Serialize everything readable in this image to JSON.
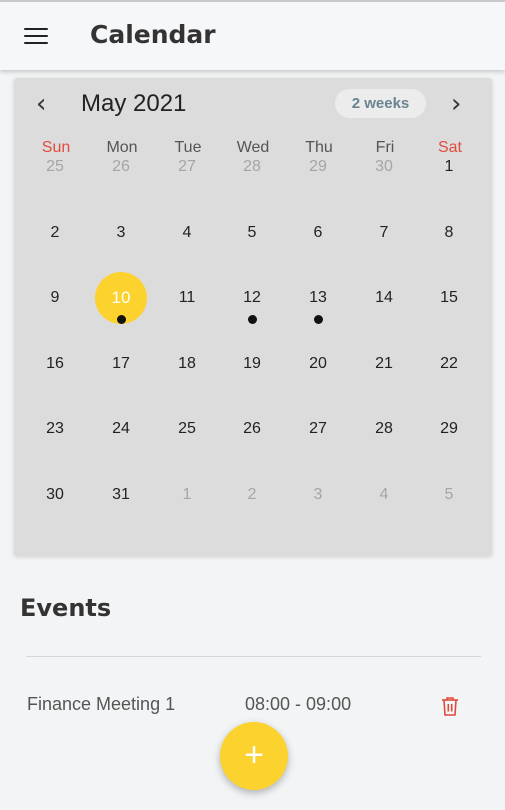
{
  "app": {
    "title": "Calendar"
  },
  "calendar": {
    "month_title": "May 2021",
    "format_button": "2 weeks",
    "days_of_week": [
      "Sun",
      "Mon",
      "Tue",
      "Wed",
      "Thu",
      "Fri",
      "Sat"
    ],
    "weeks": [
      [
        "25",
        "26",
        "27",
        "28",
        "29",
        "30",
        "1"
      ],
      [
        "2",
        "3",
        "4",
        "5",
        "6",
        "7",
        "8"
      ],
      [
        "9",
        "10",
        "11",
        "12",
        "13",
        "14",
        "15"
      ],
      [
        "16",
        "17",
        "18",
        "19",
        "20",
        "21",
        "22"
      ],
      [
        "23",
        "24",
        "25",
        "26",
        "27",
        "28",
        "29"
      ],
      [
        "30",
        "31",
        "1",
        "2",
        "3",
        "4",
        "5"
      ]
    ],
    "selected_day": "10",
    "days_with_events": [
      "10",
      "12",
      "13"
    ],
    "colors": {
      "weekend": "#e14d3d",
      "selected": "#fcd22e",
      "outside_month": "#a5a5a5"
    }
  },
  "events": {
    "title": "Events",
    "items": [
      {
        "name": "Finance Meeting 1",
        "time": "08:00 - 09:00"
      }
    ]
  },
  "fab": {
    "label": "+"
  },
  "icons": {
    "menu": "hamburger-icon",
    "prev": "chevron-left-icon",
    "next": "chevron-right-icon",
    "delete": "trash-icon"
  }
}
